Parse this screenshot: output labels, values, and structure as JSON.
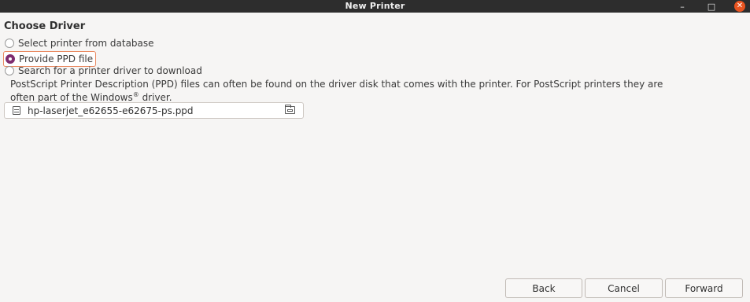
{
  "window": {
    "title": "New Printer",
    "minimize_glyph": "–",
    "maximize_glyph": "□",
    "close_glyph": "✕"
  },
  "main": {
    "heading": "Choose Driver",
    "options": [
      {
        "label": "Select printer from database",
        "selected": false
      },
      {
        "label": "Provide PPD file",
        "selected": true
      },
      {
        "label": "Search for a printer driver to download",
        "selected": false
      }
    ],
    "description_line1": "PostScript Printer Description (PPD) files can often be found on the driver disk that comes with the printer. For PostScript printers they are",
    "description_line2_pre": "often part of the Windows",
    "description_sup": "®",
    "description_line2_post": " driver.",
    "file_chooser": {
      "filename": "hp-laserjet_e62655-e62675-ps.ppd"
    }
  },
  "footer": {
    "back_label": "Back",
    "cancel_label": "Cancel",
    "forward_label": "Forward"
  },
  "colors": {
    "titlebar": "#2d2d2d",
    "close_button": "#e95420",
    "radio_selected": "#7e2c6f",
    "focus_outline": "#e98a62"
  }
}
